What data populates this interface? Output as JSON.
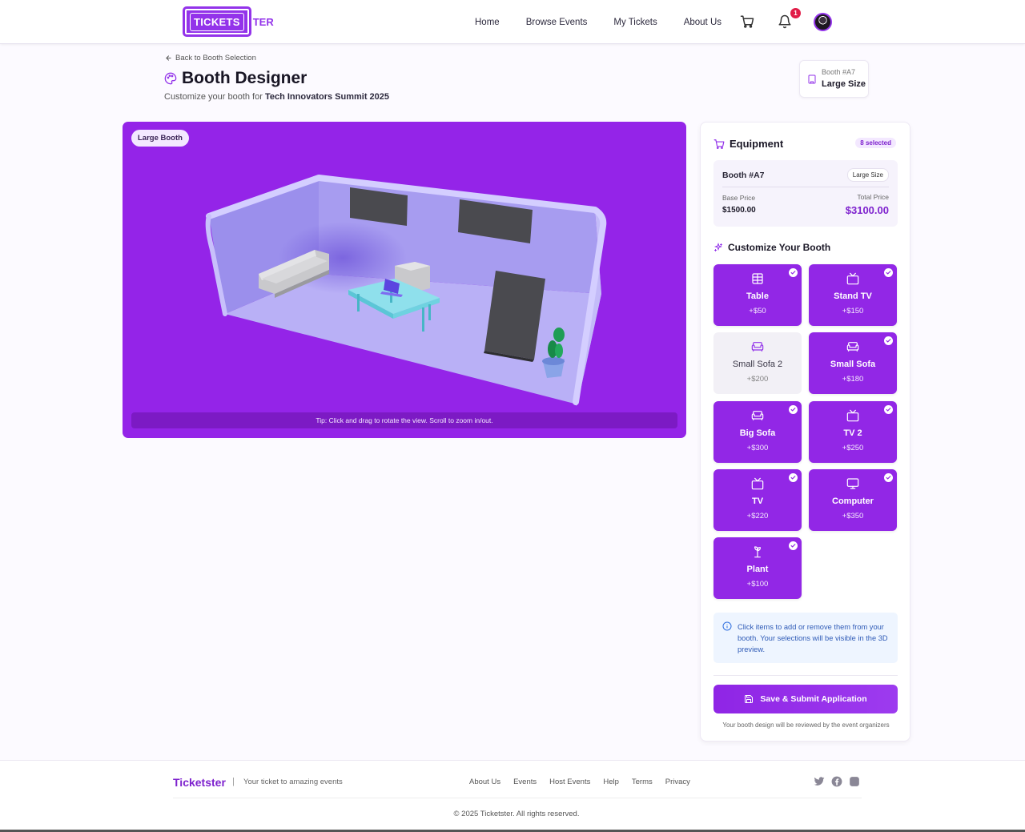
{
  "brand": {
    "logo_text": "TICKETS",
    "logo_rest": "TER",
    "name": "Ticketster",
    "accent": "#9333ea"
  },
  "nav": {
    "items": [
      {
        "label": "Home"
      },
      {
        "label": "Browse Events"
      },
      {
        "label": "My Tickets"
      },
      {
        "label": "About Us"
      }
    ],
    "cart_icon": "cart-icon",
    "bell_icon": "bell-icon",
    "notification_count": "1"
  },
  "page": {
    "back_label": "Back to Booth Selection",
    "title": "Booth Designer",
    "subtitle_prefix": "Customize your booth for",
    "event_name": "Tech Innovators Summit 2025"
  },
  "booth_chip": {
    "booth": "Booth #A7",
    "size": "Large Size"
  },
  "viewer": {
    "tag": "Large Booth",
    "tip": "Tip: Click and drag to rotate the view. Scroll to zoom in/out."
  },
  "equipment": {
    "title": "Equipment",
    "selected_badge": "8 selected",
    "booth_name": "Booth #A7",
    "booth_size": "Large Size",
    "base_price_label": "Base Price",
    "base_price": "$1500.00",
    "total_price_label": "Total Price",
    "total_price": "$3100.00",
    "customize_title": "Customize Your Booth",
    "items": [
      {
        "name": "Table",
        "price": "+$50",
        "selected": true,
        "icon": "table-icon"
      },
      {
        "name": "Stand TV",
        "price": "+$150",
        "selected": true,
        "icon": "tv-icon"
      },
      {
        "name": "Small Sofa 2",
        "price": "+$200",
        "selected": false,
        "icon": "sofa-icon"
      },
      {
        "name": "Small Sofa",
        "price": "+$180",
        "selected": true,
        "icon": "sofa-icon"
      },
      {
        "name": "Big Sofa",
        "price": "+$300",
        "selected": true,
        "icon": "sofa-icon"
      },
      {
        "name": "TV 2",
        "price": "+$250",
        "selected": true,
        "icon": "tv-icon"
      },
      {
        "name": "TV",
        "price": "+$220",
        "selected": true,
        "icon": "tv-icon"
      },
      {
        "name": "Computer",
        "price": "+$350",
        "selected": true,
        "icon": "monitor-icon"
      },
      {
        "name": "Plant",
        "price": "+$100",
        "selected": true,
        "icon": "palm-tree-icon"
      }
    ],
    "info_text": "Click items to add or remove them from your booth. Your selections will be visible in the 3D preview.",
    "save_label": "Save & Submit Application",
    "review_note": "Your booth design will be reviewed by the event organizers"
  },
  "footer": {
    "brand": "Ticketster",
    "tagline": "Your ticket to amazing events",
    "links": [
      {
        "label": "About Us"
      },
      {
        "label": "Events"
      },
      {
        "label": "Host Events"
      },
      {
        "label": "Help"
      },
      {
        "label": "Terms"
      },
      {
        "label": "Privacy"
      }
    ],
    "social_icons": [
      "twitter-icon",
      "facebook-icon",
      "instagram-icon"
    ],
    "copyright": "© 2025 Ticketster. All rights reserved."
  }
}
